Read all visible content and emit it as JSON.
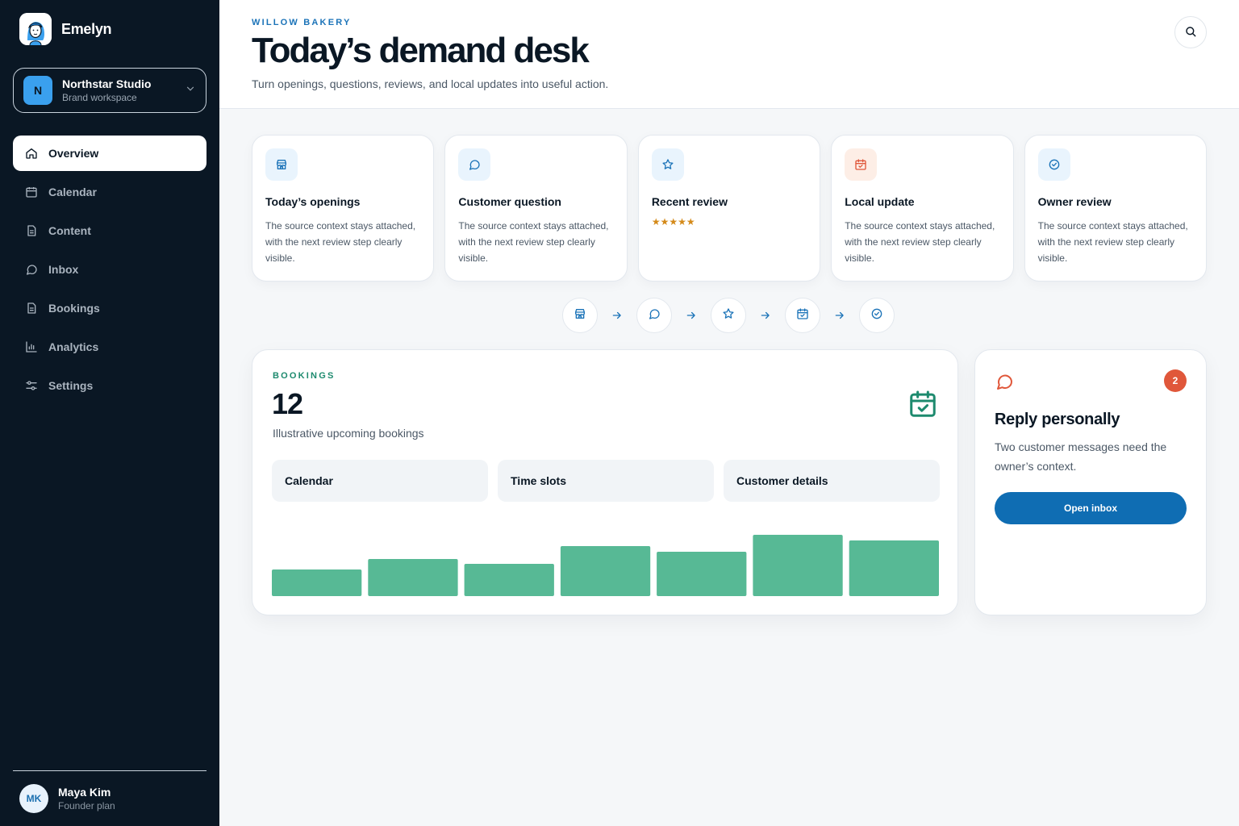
{
  "brand": {
    "name": "Emelyn"
  },
  "workspace": {
    "initial": "N",
    "name": "Northstar Studio",
    "subtitle": "Brand workspace"
  },
  "nav": [
    {
      "label": "Overview",
      "icon": "home-icon",
      "active": true
    },
    {
      "label": "Calendar",
      "icon": "calendar-icon"
    },
    {
      "label": "Content",
      "icon": "document-icon"
    },
    {
      "label": "Inbox",
      "icon": "chat-icon"
    },
    {
      "label": "Bookings",
      "icon": "document-icon"
    },
    {
      "label": "Analytics",
      "icon": "bar-chart-icon"
    },
    {
      "label": "Settings",
      "icon": "sliders-icon"
    }
  ],
  "user": {
    "initials": "MK",
    "name": "Maya Kim",
    "plan": "Founder plan"
  },
  "header": {
    "eyebrow": "WILLOW BAKERY",
    "title": "Today’s demand desk",
    "subtitle": "Turn openings, questions, reviews, and local updates into useful action."
  },
  "cards": [
    {
      "title": "Today’s openings",
      "icon": "storefront-icon",
      "body": "The source context stays attached, with the next review step clearly visible."
    },
    {
      "title": "Customer question",
      "icon": "chat-icon",
      "body": "The source context stays attached, with the next review step clearly visible."
    },
    {
      "title": "Recent review",
      "icon": "star-icon",
      "rating": 5,
      "stars": "★★★★★"
    },
    {
      "title": "Local update",
      "icon": "calendar-check-icon",
      "body": "The source context stays attached, with the next review step clearly visible."
    },
    {
      "title": "Owner review",
      "icon": "check-circle-icon",
      "body": "The source context stays attached, with the next review step clearly visible."
    }
  ],
  "flow": [
    "storefront-icon",
    "chat-icon",
    "star-icon",
    "calendar-check-icon",
    "check-circle-icon"
  ],
  "bookings": {
    "eyebrow": "BOOKINGS",
    "count": "12",
    "description": "Illustrative upcoming bookings",
    "chips": [
      "Calendar",
      "Time slots",
      "Customer details"
    ]
  },
  "chart_data": {
    "type": "bar",
    "categories": [],
    "values": [
      33,
      46,
      40,
      62,
      55,
      76,
      69
    ],
    "color": "#57b995",
    "ylim": [
      0,
      85
    ]
  },
  "reply": {
    "badge": "2",
    "title": "Reply personally",
    "body": "Two customer messages need the owner’s context.",
    "button": "Open inbox"
  },
  "colors": {
    "sidebar": "#0a1724",
    "accent": "#1b73b8",
    "green": "#1d8a6e",
    "orange": "#e0573a",
    "button": "#0f6db3"
  }
}
